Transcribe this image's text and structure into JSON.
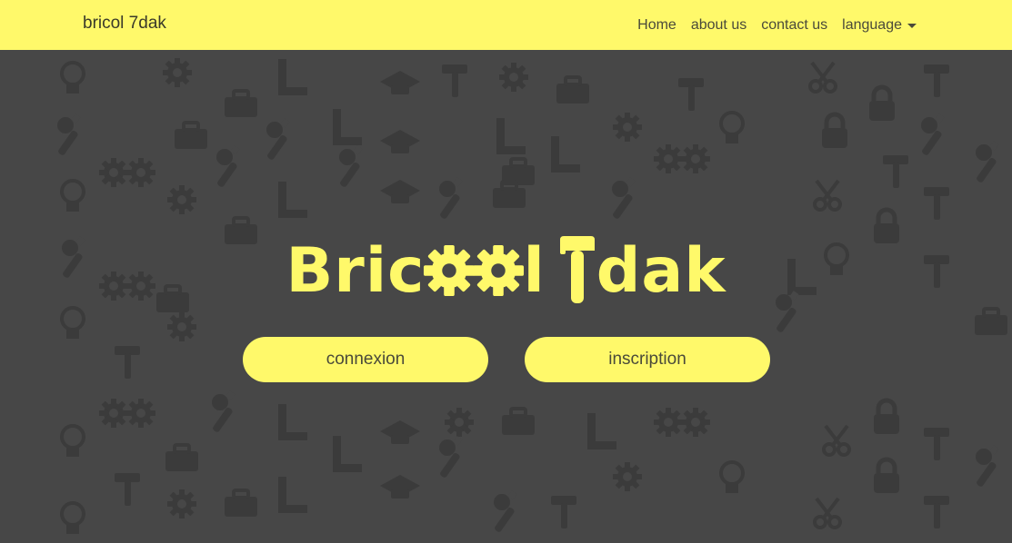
{
  "navbar": {
    "brand": "bricol 7dak",
    "links": {
      "home": "Home",
      "about": "about us",
      "contact": "contact us",
      "language": "language"
    }
  },
  "hero": {
    "title_start": "Bric",
    "title_mid": "l",
    "title_end": "dak",
    "buttons": {
      "login": "connexion",
      "signup": "inscription"
    }
  },
  "colors": {
    "accent": "#fff96a",
    "background": "#474747",
    "pattern": "#3a3a3a",
    "text_dark": "#4a4a3a"
  },
  "icons": [
    "gear-icon",
    "hammer-icon",
    "wrench-icon",
    "lightbulb-icon",
    "toolbox-icon",
    "ruler-icon",
    "graduation-cap-icon",
    "padlock-icon",
    "scissors-icon"
  ]
}
